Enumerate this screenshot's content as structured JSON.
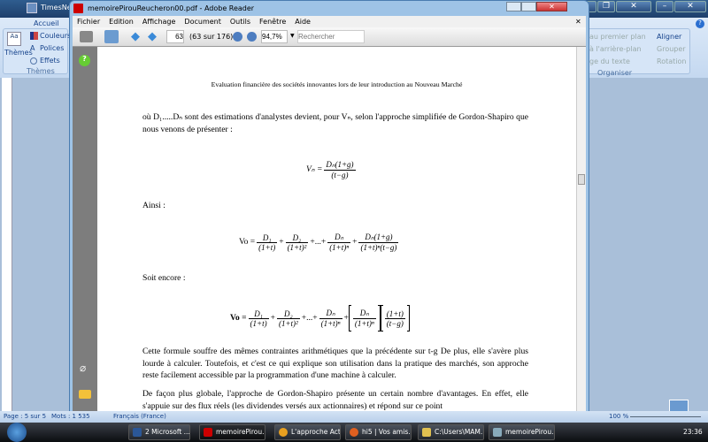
{
  "word": {
    "qat_font": "TimesNew",
    "tab": "Accueil",
    "themes_label": "Thèmes",
    "couleurs": "Couleurs",
    "polices": "Polices",
    "effets": "Effets",
    "group_themes": "Thèmes",
    "premier_plan": "au premier plan",
    "arriere_plan": "à l'arrière-plan",
    "habillage": "ge du texte",
    "aligner": "Aligner",
    "grouper": "Grouper",
    "rotation": "Rotation",
    "group_organiser": "Organiser"
  },
  "status": {
    "page": "Page : 5 sur 5",
    "words": "Mots : 1 535",
    "language": "Français (France)",
    "zoom": "100 %"
  },
  "reader": {
    "title": "memoirePirouReucheron00.pdf - Adobe Reader",
    "menu": [
      "Fichier",
      "Edition",
      "Affichage",
      "Document",
      "Outils",
      "Fenêtre",
      "Aide"
    ],
    "page_input": "63",
    "page_count": "(63 sur 176)",
    "zoom": "94,7%",
    "search_placeholder": "Rechercher"
  },
  "doc": {
    "header": "Evaluation financière des sociétés innovantes lors de leur introduction au Nouveau Marché",
    "p1": "où D₁.....Dₙ sont des estimations d'analystes devient, pour Vₙ, selon l'approche simplifiée de Gordon-Shapiro que nous venons de présenter :",
    "eq1": {
      "lhs": "Vₙ =",
      "num": "Dₙ(1+g)",
      "den": "(t−g)"
    },
    "ainsi": "Ainsi :",
    "eq2": {
      "lhs": "Vo =",
      "t1n": "D₁",
      "t1d": "(1+t)",
      "t2n": "D₂",
      "t2d": "(1+t)²",
      "dots": "+...+",
      "t3n": "Dₙ",
      "t3d": "(1+t)ⁿ",
      "t4n": "Dₙ(1+g)",
      "t4d": "(1+t)ⁿ(t−g)"
    },
    "soit": "Soit encore :",
    "eq3": {
      "lhs": "Vo =",
      "t1n": "D₁",
      "t1d": "(1+t)",
      "t2n": "D₂",
      "t2d": "(1+t)²",
      "dots": "+...+",
      "t3n": "Dₙ",
      "t3d": "(1+t)ⁿ",
      "t4n": "Dₙ",
      "t4d": "(1+t)ⁿ",
      "t5n": "(1+t)",
      "t5d": "(t−g)"
    },
    "p2": "Cette formule souffre des mêmes contraintes arithmétiques que la précédente sur t-g De plus, elle s'avère plus lourde à calculer. Toutefois, et c'est ce qui explique son utilisation dans la pratique des marchés, son approche reste facilement accessible par la programmation d'une machine à calculer.",
    "p3": "De façon plus globale, l'approche de Gordon-Shapiro présente un certain nombre d'avantages. En effet, elle s'appuie sur des flux réels (les dividendes versés aux actionnaires) et répond sur ce point"
  },
  "taskbar": {
    "tasks": [
      "2 Microsoft ...",
      "memoirePirou...",
      "L'approche Act...",
      "hi5 | Vos amis. ...",
      "C:\\Users\\MAM...",
      "memoirePirou..."
    ],
    "clock": "23:36"
  }
}
